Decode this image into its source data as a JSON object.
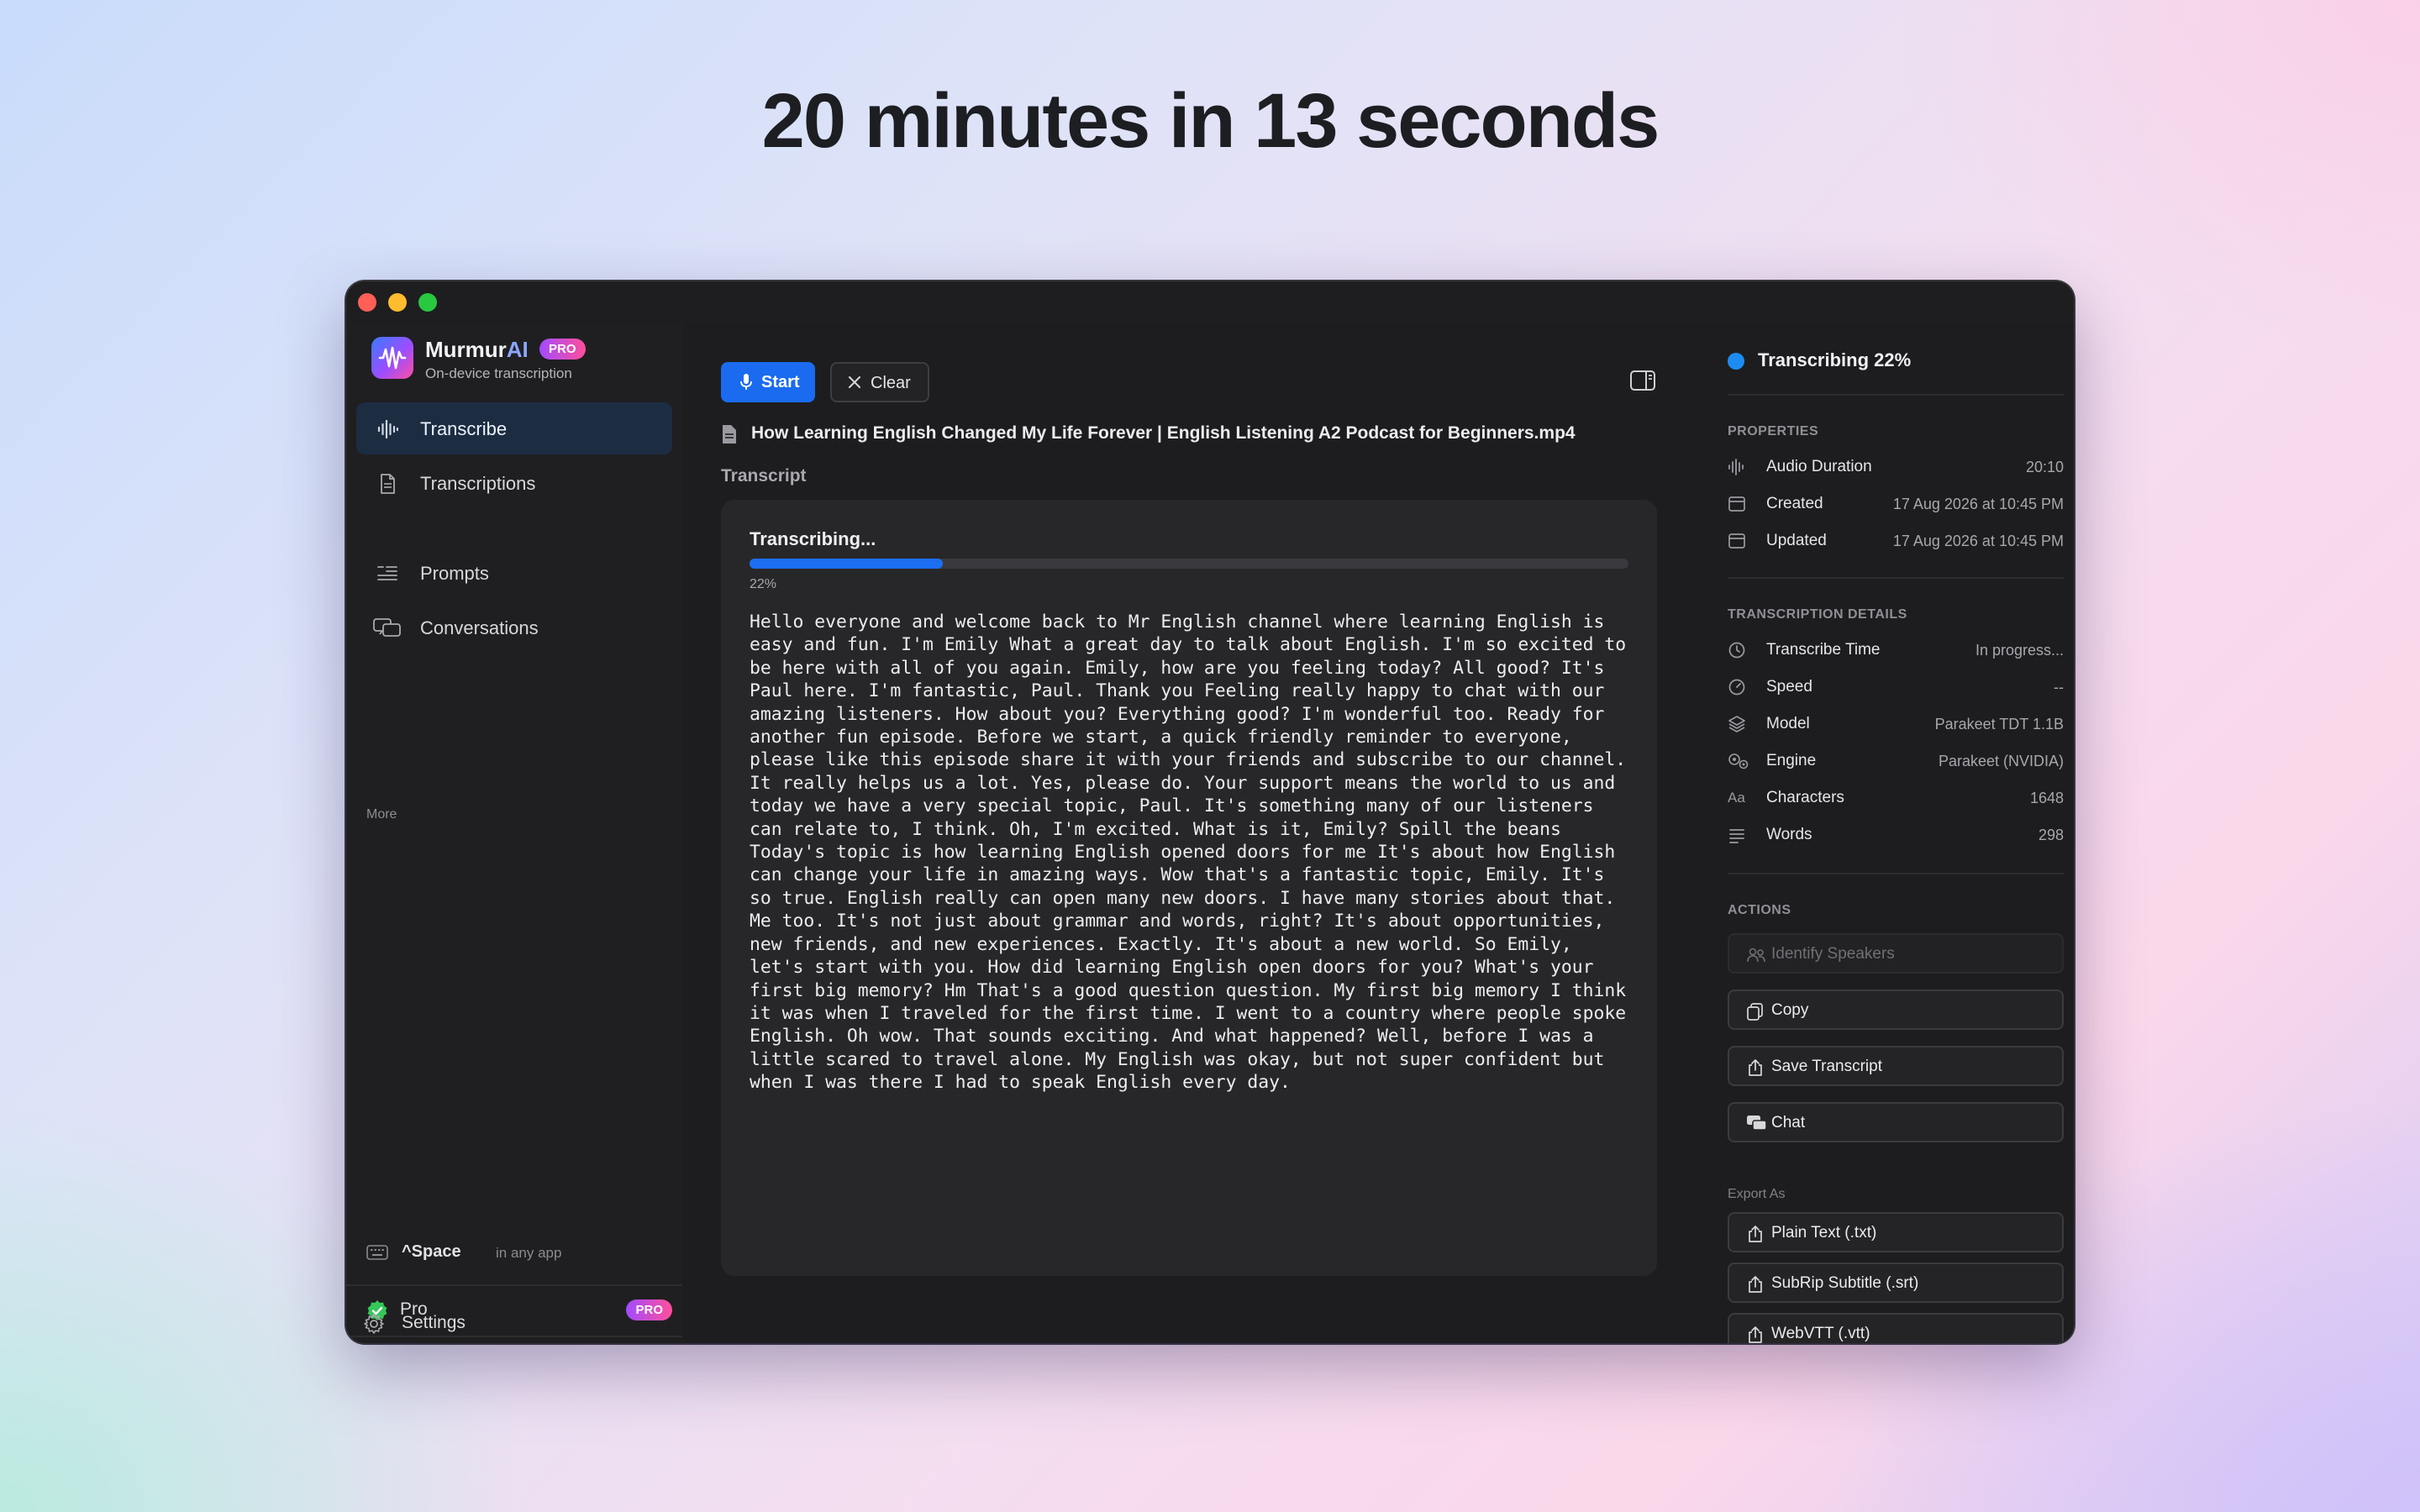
{
  "headline": "20 minutes in 13 seconds",
  "app": {
    "name_main": "Murmur",
    "name_ai": "AI",
    "badge": "PRO",
    "subtitle": "On-device transcription"
  },
  "sidebar": {
    "items": [
      {
        "label": "Transcribe",
        "icon": "waveform-icon",
        "active": true
      },
      {
        "label": "Transcriptions",
        "icon": "document-icon",
        "active": false
      }
    ],
    "section_more": "More",
    "more_items": [
      {
        "label": "Prompts",
        "icon": "list-quote-icon"
      },
      {
        "label": "Conversations",
        "icon": "chat-bubbles-icon"
      }
    ],
    "hotkey": {
      "keys": "^Space",
      "hint": "in any app"
    },
    "pro": {
      "label": "Pro",
      "badge": "PRO"
    },
    "settings": {
      "label": "Settings"
    }
  },
  "toolbar": {
    "start_label": "Start",
    "clear_label": "Clear"
  },
  "file": {
    "name": "How Learning English Changed My Life Forever | English Listening A2 Podcast for Beginners.mp4"
  },
  "transcript": {
    "section_label": "Transcript",
    "status": "Transcribing...",
    "progress": 0.22,
    "progress_label": "22%",
    "text": "Hello everyone and welcome back to Mr English channel where learning English is easy and fun. I'm Emily What a great day to talk about English. I'm so excited to be here with all of you again. Emily, how are you feeling today? All good? It's Paul here. I'm fantastic, Paul. Thank you Feeling really happy to chat with our amazing listeners. How about you? Everything good? I'm wonderful too. Ready for another fun episode. Before we start, a quick friendly reminder to everyone, please like this episode share it with your friends and subscribe to our channel. It really helps us a lot. Yes, please do. Your support means the world to us and today we have a very special topic, Paul. It's something many of our listeners can relate to, I think. Oh, I'm excited. What is it, Emily? Spill the beans Today's topic is how learning English opened doors for me It's about how English can change your life in amazing ways. Wow that's a fantastic topic, Emily. It's so true. English really can open many new doors. I have many stories about that. Me too. It's not just about grammar and words, right? It's about opportunities, new friends, and new experiences. Exactly. It's about a new world. So Emily, let's start with you. How did learning English open doors for you? What's your first big memory? Hm That's a good question question. My first big memory I think it was when I traveled for the first time. I went to a country where people spoke English. Oh wow. That sounds exciting. And what happened? Well, before I was a little scared to travel alone. My English was okay, but not super confident but when I was there I had to speak English every day."
  },
  "panel": {
    "status": "Transcribing 22%",
    "properties_heading": "PROPERTIES",
    "properties": [
      {
        "key": "Audio Duration",
        "value": "20:10",
        "icon": "waveform-icon"
      },
      {
        "key": "Created",
        "value": "17 Aug 2026 at 10:45 PM",
        "icon": "calendar-icon"
      },
      {
        "key": "Updated",
        "value": "17 Aug 2026 at 10:45 PM",
        "icon": "calendar-icon"
      }
    ],
    "details_heading": "TRANSCRIPTION DETAILS",
    "details": [
      {
        "key": "Transcribe Time",
        "value": "In progress...",
        "icon": "clock-icon"
      },
      {
        "key": "Speed",
        "value": "--",
        "icon": "gauge-icon"
      },
      {
        "key": "Model",
        "value": "Parakeet TDT 1.1B",
        "icon": "layers-icon"
      },
      {
        "key": "Engine",
        "value": "Parakeet (NVIDIA)",
        "icon": "gears-icon"
      },
      {
        "key": "Characters",
        "value": "1648",
        "icon": "text-size-icon"
      },
      {
        "key": "Words",
        "value": "298",
        "icon": "lines-icon"
      }
    ],
    "actions_heading": "ACTIONS",
    "actions": [
      {
        "label": "Identify Speakers",
        "icon": "people-icon",
        "disabled": true
      },
      {
        "label": "Copy",
        "icon": "copy-icon",
        "disabled": false
      },
      {
        "label": "Save Transcript",
        "icon": "share-icon",
        "disabled": false
      },
      {
        "label": "Chat",
        "icon": "chat-bubbles-icon",
        "disabled": false
      }
    ],
    "export_heading": "Export As",
    "exports": [
      {
        "label": "Plain Text (.txt)",
        "icon": "share-icon"
      },
      {
        "label": "SubRip Subtitle (.srt)",
        "icon": "share-icon"
      },
      {
        "label": "WebVTT (.vtt)",
        "icon": "share-icon"
      }
    ]
  },
  "colors": {
    "accent": "#1a6bf0",
    "status_dot": "#1d8cf2",
    "pro_check": "#34c759"
  }
}
